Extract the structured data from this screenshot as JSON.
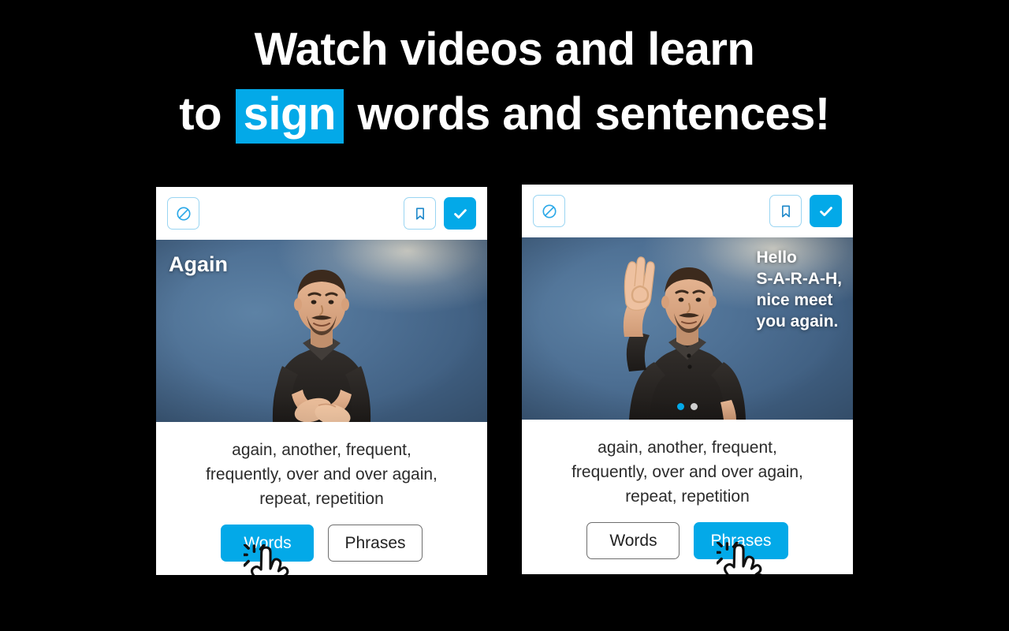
{
  "headline": {
    "line1": "Watch videos and learn",
    "line2_before": "to ",
    "line2_mark": "sign",
    "line2_after": " words and sentences!"
  },
  "colors": {
    "accent": "#03A9E8",
    "background": "#000000",
    "card": "#ffffff",
    "dot_inactive": "#cfcfcf"
  },
  "cards": [
    {
      "toolbar": {
        "block_icon": "block-icon",
        "bookmark_icon": "bookmark-icon",
        "check_icon": "check-icon"
      },
      "video": {
        "overlay_word": "Again",
        "has_pagination": false
      },
      "caption": {
        "line1": "again, another, frequent,",
        "line2": "frequently, over and over again,",
        "line3": "repeat, repetition"
      },
      "tabs": [
        {
          "label": "Words",
          "active": true,
          "cursor": true
        },
        {
          "label": "Phrases",
          "active": false,
          "cursor": false
        }
      ]
    },
    {
      "toolbar": {
        "block_icon": "block-icon",
        "bookmark_icon": "bookmark-icon",
        "check_icon": "check-icon"
      },
      "video": {
        "overlay_phrase_line1": "Hello",
        "overlay_phrase_line2": "S-A-R-A-H,",
        "overlay_phrase_line3": "nice meet",
        "overlay_phrase_line4": "you again.",
        "has_pagination": true,
        "pagination_total": 2,
        "pagination_active_index": 1
      },
      "caption": {
        "line1": "again, another, frequent,",
        "line2": "frequently, over and over again,",
        "line3": "repeat, repetition"
      },
      "tabs": [
        {
          "label": "Words",
          "active": false,
          "cursor": false
        },
        {
          "label": "Phrases",
          "active": true,
          "cursor": true
        }
      ]
    }
  ]
}
